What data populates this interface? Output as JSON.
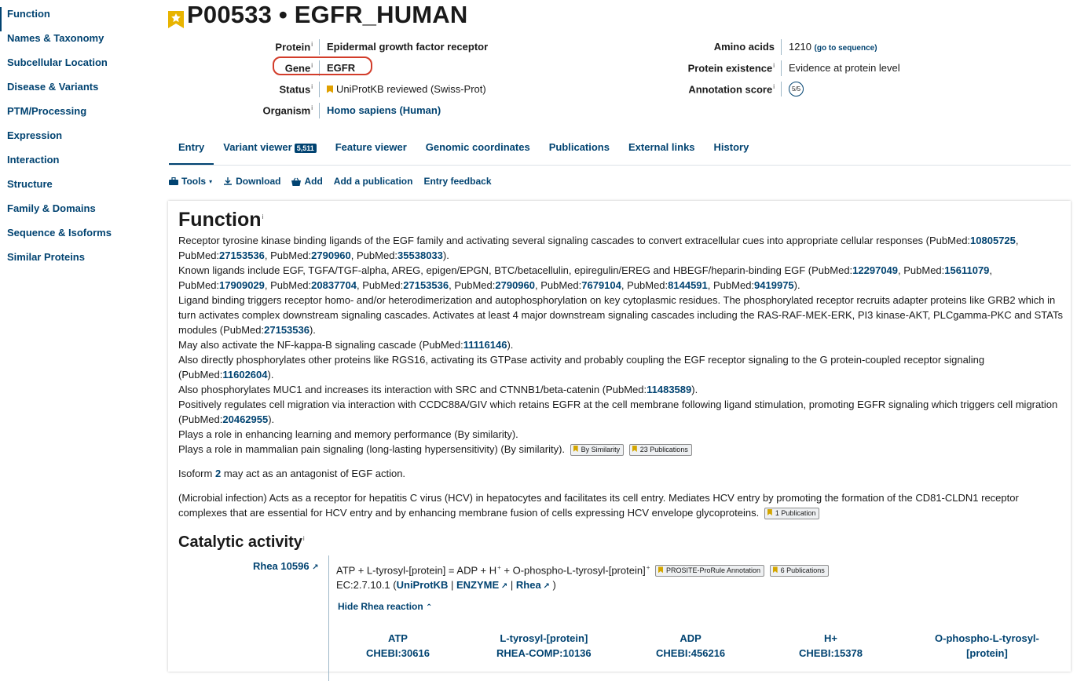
{
  "sidebar": {
    "items": [
      {
        "label": "Function"
      },
      {
        "label": "Names & Taxonomy"
      },
      {
        "label": "Subcellular Location"
      },
      {
        "label": "Disease & Variants"
      },
      {
        "label": "PTM/Processing"
      },
      {
        "label": "Expression"
      },
      {
        "label": "Interaction"
      },
      {
        "label": "Structure"
      },
      {
        "label": "Family & Domains"
      },
      {
        "label": "Sequence & Isoforms"
      },
      {
        "label": "Similar Proteins"
      }
    ]
  },
  "header": {
    "title": "P00533 • EGFR_HUMAN",
    "protein_label": "Protein",
    "protein_value": "Epidermal growth factor receptor",
    "gene_label": "Gene",
    "gene_value": "EGFR",
    "status_label": "Status",
    "status_value": "UniProtKB reviewed (Swiss-Prot)",
    "organism_label": "Organism",
    "organism_value": "Homo sapiens (Human)",
    "amino_label": "Amino acids",
    "amino_value": "1210",
    "amino_link": "(go to sequence)",
    "existence_label": "Protein existence",
    "existence_value": "Evidence at protein level",
    "score_label": "Annotation score",
    "score_value": "5/5",
    "info_mark": "i"
  },
  "tabs": [
    {
      "label": "Entry"
    },
    {
      "label": "Variant viewer",
      "badge": "5,511"
    },
    {
      "label": "Feature viewer"
    },
    {
      "label": "Genomic coordinates"
    },
    {
      "label": "Publications"
    },
    {
      "label": "External links"
    },
    {
      "label": "History"
    }
  ],
  "toolbar": {
    "tools": "Tools",
    "download": "Download",
    "add": "Add",
    "add_publication": "Add a publication",
    "feedback": "Entry feedback"
  },
  "function": {
    "heading": "Function",
    "p1_a": "Receptor tyrosine kinase binding ligands of the EGF family and activating several signaling cascades to convert extracellular cues into appropriate cellular responses (PubMed:",
    "p1_pm1": "10805725",
    "p1_b": ", PubMed:",
    "p1_pm2": "27153536",
    "p1_c": ", PubMed:",
    "p1_pm3": "2790960",
    "p1_d": ", PubMed:",
    "p1_pm4": "35538033",
    "p1_e": ").",
    "p2_a": "Known ligands include EGF, TGFA/TGF-alpha, AREG, epigen/EPGN, BTC/betacellulin, epiregulin/EREG and HBEGF/heparin-binding EGF (PubMed:",
    "p2_pm1": "12297049",
    "p2_b": ", PubMed:",
    "p2_pm2": "15611079",
    "p2_c": ", PubMed:",
    "p2_pm3": "17909029",
    "p2_d": ", PubMed:",
    "p2_pm4": "20837704",
    "p2_e": ", PubMed:",
    "p2_pm5": "27153536",
    "p2_f": ", PubMed:",
    "p2_pm6": "2790960",
    "p2_g": ", PubMed:",
    "p2_pm7": "7679104",
    "p2_h": ", PubMed:",
    "p2_pm8": "8144591",
    "p2_i": ", PubMed:",
    "p2_pm9": "9419975",
    "p2_j": ").",
    "p3_a": "Ligand binding triggers receptor homo- and/or heterodimerization and autophosphorylation on key cytoplasmic residues. The phosphorylated receptor recruits adapter proteins like GRB2 which in turn activates complex downstream signaling cascades. Activates at least 4 major downstream signaling cascades including the RAS-RAF-MEK-ERK, PI3 kinase-AKT, PLCgamma-PKC and STATs modules (PubMed:",
    "p3_pm1": "27153536",
    "p3_b": ").",
    "p4_a": "May also activate the NF-kappa-B signaling cascade (PubMed:",
    "p4_pm1": "11116146",
    "p4_b": ").",
    "p5_a": "Also directly phosphorylates other proteins like RGS16, activating its GTPase activity and probably coupling the EGF receptor signaling to the G protein-coupled receptor signaling (PubMed:",
    "p5_pm1": "11602604",
    "p5_b": ").",
    "p6_a": "Also phosphorylates MUC1 and increases its interaction with SRC and CTNNB1/beta-catenin (PubMed:",
    "p6_pm1": "11483589",
    "p6_b": ").",
    "p7_a": "Positively regulates cell migration via interaction with CCDC88A/GIV which retains EGFR at the cell membrane following ligand stimulation, promoting EGFR signaling which triggers cell migration (PubMed:",
    "p7_pm1": "20462955",
    "p7_b": ").",
    "p8": "Plays a role in enhancing learning and memory performance (By similarity).",
    "p9": "Plays a role in mammalian pain signaling (long-lasting hypersensitivity) (By similarity).",
    "p9_tag1": "By Similarity",
    "p9_tag2": "23 Publications",
    "p10_a": "Isoform ",
    "p10_link": "2",
    "p10_b": " may act as an antagonist of EGF action.",
    "p11": "(Microbial infection) Acts as a receptor for hepatitis C virus (HCV) in hepatocytes and facilitates its cell entry. Mediates HCV entry by promoting the formation of the CD81-CLDN1 receptor complexes that are essential for HCV entry and by enhancing membrane fusion of cells expressing HCV envelope glycoproteins.",
    "p11_tag": "1 Publication"
  },
  "catalytic": {
    "heading": "Catalytic activity",
    "rhea": "Rhea 10596",
    "reaction": "ATP + L-tyrosyl-[protein] = ADP + H",
    "reaction_b": " + O-phospho-L-tyrosyl-[protein]",
    "plus_mark": "+",
    "tag1": "PROSITE-ProRule Annotation",
    "tag2": "6 Publications",
    "ec_a": "EC:2.7.10.1 (",
    "ec_uniprot": "UniProtKB",
    "ec_sep1": " | ",
    "ec_enzyme": "ENZYME",
    "ec_sep2": " | ",
    "ec_rhea": "Rhea",
    "ec_b": " )",
    "hide": "Hide Rhea reaction",
    "chems": [
      {
        "name": "ATP",
        "id": "CHEBI:30616"
      },
      {
        "name": "L-tyrosyl-[protein]",
        "id": "RHEA-COMP:10136"
      },
      {
        "name": "ADP",
        "id": "CHEBI:456216"
      },
      {
        "name": "H+",
        "id": "CHEBI:15378"
      },
      {
        "name": "O-phospho-L-tyrosyl-",
        "name2": "[protein]"
      }
    ]
  }
}
